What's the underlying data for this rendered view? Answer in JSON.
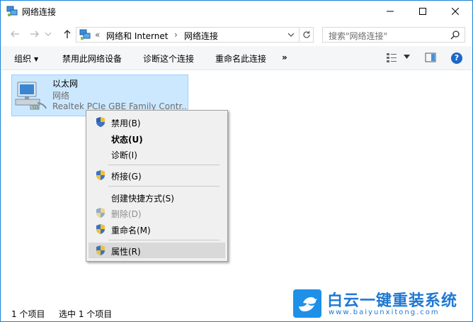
{
  "window": {
    "title": "网络连接"
  },
  "address": {
    "prefix": "«",
    "crumbs": [
      "网络和 Internet",
      "网络连接"
    ],
    "separator": "›"
  },
  "search": {
    "placeholder": "搜索\"网络连接\""
  },
  "commands": {
    "organize": "组织",
    "disable_device": "禁用此网络设备",
    "diagnose": "诊断这个连接",
    "rename": "重命名此连接",
    "more": "»"
  },
  "help_label": "?",
  "item": {
    "name": "以太网",
    "status": "网络",
    "device": "Realtek PCIe GBE Family Contr..."
  },
  "context_menu": {
    "items": [
      {
        "label": "禁用(B)",
        "shield": true
      },
      {
        "label": "状态(U)",
        "bold": true
      },
      {
        "label": "诊断(I)"
      },
      {
        "label": "桥接(G)",
        "shield": true
      },
      {
        "label": "创建快捷方式(S)"
      },
      {
        "label": "删除(D)",
        "shield": true,
        "disabled": true
      },
      {
        "label": "重命名(M)",
        "shield": true
      },
      {
        "label": "属性(R)",
        "shield": true,
        "highlighted": true
      }
    ]
  },
  "status": {
    "count": "1 个项目",
    "selected": "选中 1 个项目"
  },
  "watermark": {
    "title": "白云一键重装系统",
    "url": "www.baiyunxitong.com"
  },
  "colors": {
    "selection": "#cce8ff",
    "accent": "#1883d7",
    "menu_bg": "#f0f0f0",
    "watermark": "#1e78d2"
  }
}
